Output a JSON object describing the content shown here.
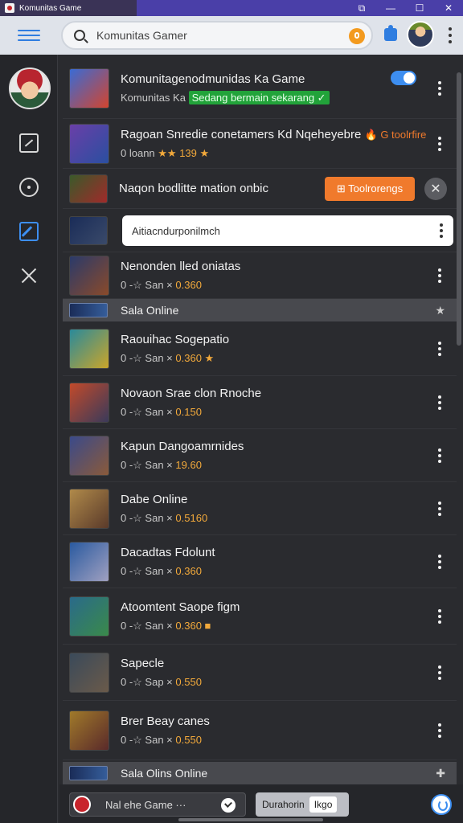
{
  "window": {
    "title": "Komunitas Game"
  },
  "header": {
    "search_value": "Komunitas Gamer",
    "search_placeholder": "Search"
  },
  "rows": [
    {
      "title": "Komunitagenodmunidas Ka Game",
      "sub_label": "Komunitas Ka",
      "badge": "Sedang bermain sekarang ✓",
      "thumb_colors": [
        "#3a6bd4",
        "#d2452f"
      ]
    },
    {
      "title": "Ragoan Snredie conetamers Kd Nqeheyebre",
      "sub_prefix": "0 loann",
      "sub_hl": "★★ 139 ★",
      "sub_orange": "🔥 G toolrfire",
      "thumb_colors": [
        "#6a3fa8",
        "#2a4fa0"
      ]
    },
    {
      "title": "Naqon bodlitte mation onbic",
      "button_label": "⊞ Toolrorengs",
      "thumb_colors": [
        "#3a5a2a",
        "#a02a2a"
      ]
    },
    {
      "input_value": "Aitiacndurponilmch",
      "thumb_colors": [
        "#1a2c58",
        "#3a4a6a"
      ]
    },
    {
      "title": "Nenonden lled oniatas",
      "sub_prefix": "0 -☆ San ×",
      "sub_hl": "0.360",
      "thumb_colors": [
        "#2a3a6a",
        "#8a4a2a"
      ]
    }
  ],
  "section_1": {
    "title": "Sala Online",
    "icon": "star-icon"
  },
  "games": [
    {
      "title": "Raouihac Sogepatio",
      "sub_prefix": "0 -☆ San ×",
      "sub_hl": "0.360 ★",
      "thumb_colors": [
        "#2a8a9a",
        "#caa52a"
      ]
    },
    {
      "title": "Novaon Srae clon Rnoche",
      "sub_prefix": "0 -☆ San ×",
      "sub_hl": "0.150",
      "thumb_colors": [
        "#c24a2a",
        "#3a3a5a"
      ]
    },
    {
      "title": "Kapun Dangoamrnides",
      "sub_prefix": "0 -☆ San ×",
      "sub_hl": "19.60",
      "thumb_colors": [
        "#3a4a8a",
        "#8a5a3a"
      ]
    },
    {
      "title": "Dabe Online",
      "sub_prefix": "0 -☆ San ×",
      "sub_hl": "0.5160",
      "thumb_colors": [
        "#b08a4a",
        "#5a3a2a"
      ]
    },
    {
      "title": "Dacadtas Fdolunt",
      "sub_prefix": "0 -☆ San ×",
      "sub_hl": "0.360",
      "thumb_colors": [
        "#2a5aa0",
        "#a0a0c0"
      ]
    },
    {
      "title": "Atoomtent Saope figm",
      "sub_prefix": "0 -☆ San ×",
      "sub_hl": "0.360 ■",
      "thumb_colors": [
        "#2a6a8a",
        "#3a8a4a"
      ]
    },
    {
      "title": "Sapecle",
      "sub_prefix": "0 -☆ Sap ×",
      "sub_hl": "0.550",
      "thumb_colors": [
        "#3a4a5a",
        "#6a5a4a"
      ]
    },
    {
      "title": "Brer Beay canes",
      "sub_prefix": "0 -☆ San ×",
      "sub_hl": "0.550",
      "thumb_colors": [
        "#a07a2a",
        "#5a2a2a"
      ]
    }
  ],
  "section_2": {
    "title": "Sala Olins Online",
    "icon": "plus-icon"
  },
  "bottom": {
    "pill_label": "Nal ehe Game ···",
    "button_label": "Durahorin",
    "button_inner": "Ikgo"
  }
}
